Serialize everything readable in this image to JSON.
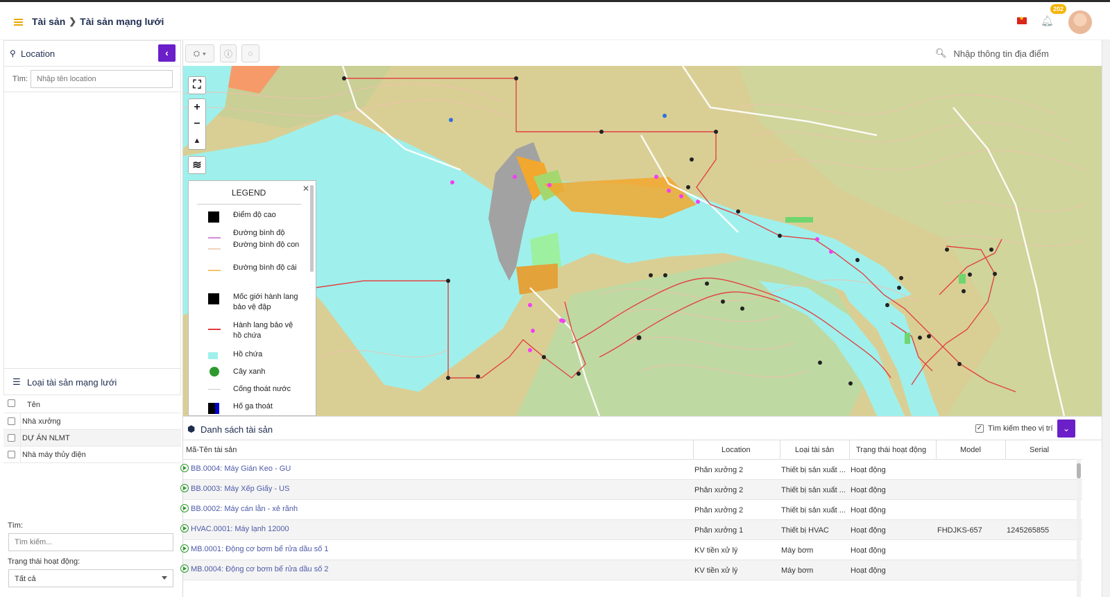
{
  "breadcrumb": {
    "root": "Tài sản",
    "current": "Tài sản mạng lưới"
  },
  "header": {
    "notification_count": "202"
  },
  "location_panel": {
    "title": "Location",
    "search_label": "Tìm:",
    "search_placeholder": "Nhập tên location"
  },
  "asset_types": {
    "title": "Loại tài sản mạng lưới",
    "column_header": "Tên",
    "items": [
      "Nhà xưởng",
      "DỰ ÁN NLMT",
      "Nhà máy thủy điện"
    ]
  },
  "filters": {
    "search_label": "Tìm:",
    "search_placeholder": "Tìm kiếm...",
    "status_label": "Trạng thái hoạt động:",
    "status_value": "Tất cả"
  },
  "map": {
    "search_placeholder": "Nhập thông tin địa điểm",
    "legend": {
      "title": "LEGEND",
      "items": [
        {
          "label": "Điểm độ cao",
          "color": "#000000"
        },
        {
          "label": "Đường bình độ",
          "color": "#d98bd9"
        },
        {
          "label": "Đường bình độ con",
          "color": "#f3d2c0"
        },
        {
          "label": "Đường bình độ cái",
          "color": "#f2c46a"
        },
        {
          "label": "Mốc giới hành lang bảo vệ đập",
          "color": "#000000"
        },
        {
          "label": "Hành lang bảo vệ hồ chứa",
          "color": "#e23b3b"
        },
        {
          "label": "Hồ chứa",
          "color": "#9ff0ec"
        },
        {
          "label": "Cây xanh",
          "color": "#2e9a2e"
        },
        {
          "label": "Cống thoát nước",
          "color": "#cccccc"
        },
        {
          "label": "Hố ga thoát",
          "color": "#0000cc"
        }
      ]
    }
  },
  "asset_list": {
    "title": "Danh sách tài sản",
    "position_filter_label": "Tìm kiếm theo vị trí",
    "columns": [
      "Mã-Tên tài sản",
      "Location",
      "Loại tài sản",
      "Trạng thái hoạt động",
      "Model",
      "Serial"
    ],
    "rows": [
      {
        "name": "BB.0004: Máy Gián Keo - GU",
        "location": "Phân xưởng 2",
        "type": "Thiết bị sản xuất ...",
        "status": "Hoạt động",
        "model": "",
        "serial": ""
      },
      {
        "name": "BB.0003: Máy Xếp Giấy - US",
        "location": "Phân xưởng 2",
        "type": "Thiết bị sản xuất ...",
        "status": "Hoạt động",
        "model": "",
        "serial": ""
      },
      {
        "name": "BB.0002: Máy cán lằn - xẻ rãnh",
        "location": "Phân xưởng 2",
        "type": "Thiết bị sản xuất ...",
        "status": "Hoạt động",
        "model": "",
        "serial": ""
      },
      {
        "name": "HVAC.0001: Máy lạnh 12000",
        "location": "Phân xưởng 1",
        "type": "Thiết bị HVAC",
        "status": "Hoạt động",
        "model": "FHDJKS-657",
        "serial": "1245265855"
      },
      {
        "name": "MB.0001: Động cơ bơm bể rửa dầu số 1",
        "location": "KV tiền xử lý",
        "type": "Máy bơm",
        "status": "Hoạt động",
        "model": "",
        "serial": ""
      },
      {
        "name": "MB.0004: Động cơ bơm bể rửa dầu số 2",
        "location": "KV tiền xử lý",
        "type": "Máy bơm",
        "status": "Hoạt động",
        "model": "",
        "serial": ""
      }
    ]
  }
}
